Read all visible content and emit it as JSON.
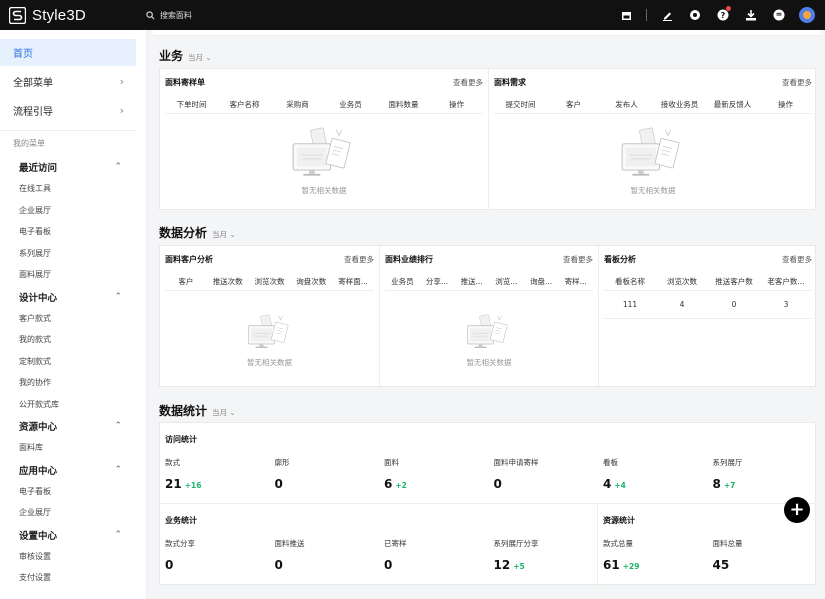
{
  "app": {
    "name": "Style3D"
  },
  "search": {
    "placeholder": "搜索面料"
  },
  "sidebar": {
    "top": [
      {
        "label": "首页",
        "chev": ""
      },
      {
        "label": "全部菜单",
        "chev": "›"
      },
      {
        "label": "流程引导",
        "chev": "›"
      }
    ],
    "my_menu": "我的菜单",
    "groups": [
      {
        "label": "最近访问",
        "items": [
          "在线工具",
          "企业展厅",
          "电子看板",
          "系列展厅",
          "面料展厅"
        ]
      },
      {
        "label": "设计中心",
        "items": [
          "客户款式",
          "我的款式",
          "定制款式",
          "我的协作",
          "公开款式库"
        ]
      },
      {
        "label": "资源中心",
        "items": [
          "面料库"
        ]
      },
      {
        "label": "应用中心",
        "items": [
          "电子看板",
          "企业展厅"
        ]
      },
      {
        "label": "设置中心",
        "items": [
          "审核设置",
          "支付设置"
        ]
      }
    ]
  },
  "business": {
    "title": "业务",
    "period": "当月",
    "sample": {
      "title": "面料寄样单",
      "more": "查看更多",
      "cols": [
        "下单时间",
        "客户名称",
        "采购商",
        "业务员",
        "面料数量",
        "操作"
      ],
      "empty": "暂无相关数据"
    },
    "demand": {
      "title": "面料需求",
      "more": "查看更多",
      "cols": [
        "提交时间",
        "客户",
        "发布人",
        "接收业务员",
        "最新反馈人",
        "操作"
      ],
      "empty": "暂无相关数据"
    }
  },
  "analysis": {
    "title": "数据分析",
    "period": "当月",
    "customer": {
      "title": "面料客户分析",
      "more": "查看更多",
      "cols": [
        "客户",
        "推送次数",
        "浏览次数",
        "询盘次数",
        "寄样面..."
      ],
      "empty": "暂无相关数据"
    },
    "ranking": {
      "title": "面料业绩排行",
      "more": "查看更多",
      "cols": [
        "业务员",
        "分享...",
        "推送...",
        "浏览...",
        "询盘...",
        "寄样..."
      ],
      "empty": "暂无相关数据"
    },
    "board": {
      "title": "看板分析",
      "more": "查看更多",
      "cols": [
        "看板名称",
        "浏览次数",
        "推送客户数",
        "老客户数..."
      ],
      "row": [
        "111",
        "4",
        "0",
        "3"
      ]
    }
  },
  "stats": {
    "title": "数据统计",
    "period": "当月",
    "visit": {
      "title": "访问统计",
      "items": [
        {
          "label": "款式",
          "value": "21",
          "inc": "+16"
        },
        {
          "label": "廓形",
          "value": "0",
          "inc": ""
        },
        {
          "label": "面料",
          "value": "6",
          "inc": "+2"
        },
        {
          "label": "面料申请寄样",
          "value": "0",
          "inc": ""
        },
        {
          "label": "看板",
          "value": "4",
          "inc": "+4"
        },
        {
          "label": "系列展厅",
          "value": "8",
          "inc": "+7"
        }
      ]
    },
    "business": {
      "title": "业务统计",
      "items": [
        {
          "label": "款式分享",
          "value": "0",
          "inc": ""
        },
        {
          "label": "面料推送",
          "value": "0",
          "inc": ""
        },
        {
          "label": "已寄样",
          "value": "0",
          "inc": ""
        },
        {
          "label": "系列展厅分享",
          "value": "12",
          "inc": "+5"
        }
      ]
    },
    "resource": {
      "title": "资源统计",
      "items": [
        {
          "label": "款式总量",
          "value": "61",
          "inc": "+29"
        },
        {
          "label": "面料总量",
          "value": "45",
          "inc": ""
        }
      ]
    }
  },
  "fab": {
    "label": "+"
  },
  "colors": {
    "accent": "#2a6fdb",
    "increase": "#1bb46a",
    "topbar": "#111111"
  }
}
